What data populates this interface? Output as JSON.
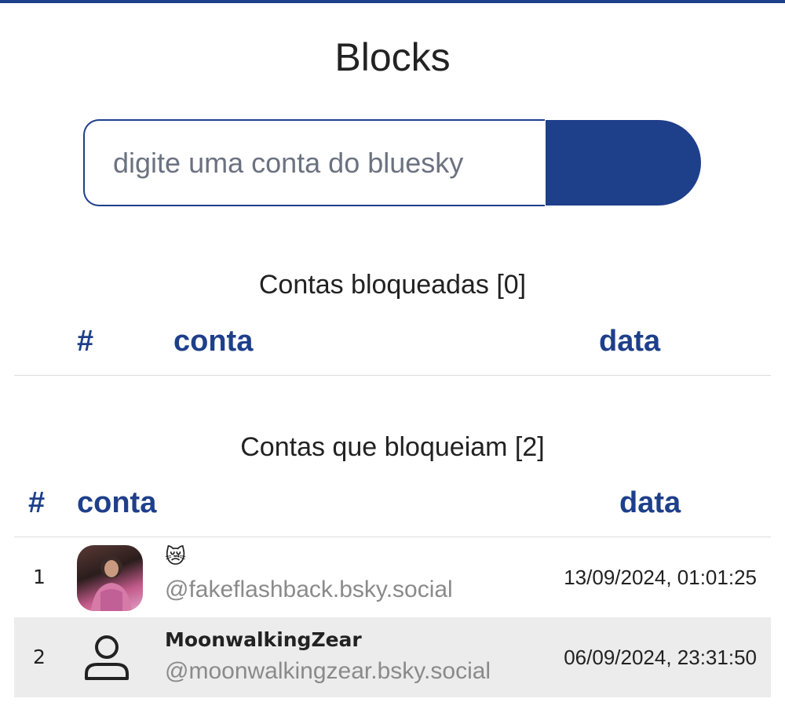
{
  "page": {
    "title": "Blocks"
  },
  "search": {
    "placeholder": "digite uma conta do bluesky",
    "value": ""
  },
  "blocked": {
    "title": "Contas bloqueadas [0]",
    "headers": {
      "num": "#",
      "account": "conta",
      "date": "data"
    }
  },
  "blocking": {
    "title": "Contas que bloqueiam [2]",
    "headers": {
      "num": "#",
      "account": "conta",
      "date": "data"
    },
    "rows": [
      {
        "num": "1",
        "display_name": "😿",
        "handle": "@fakeflashback.bsky.social",
        "date": "13/09/2024, 01:01:25",
        "avatar": "photo"
      },
      {
        "num": "2",
        "display_name": "MoonwalkingZear",
        "handle": "@moonwalkingzear.bsky.social",
        "date": "06/09/2024, 23:31:50",
        "avatar": "user-icon"
      }
    ]
  },
  "colors": {
    "accent": "#1e3f8a",
    "row_alt": "#ececec",
    "handle": "#8a8a8a"
  }
}
